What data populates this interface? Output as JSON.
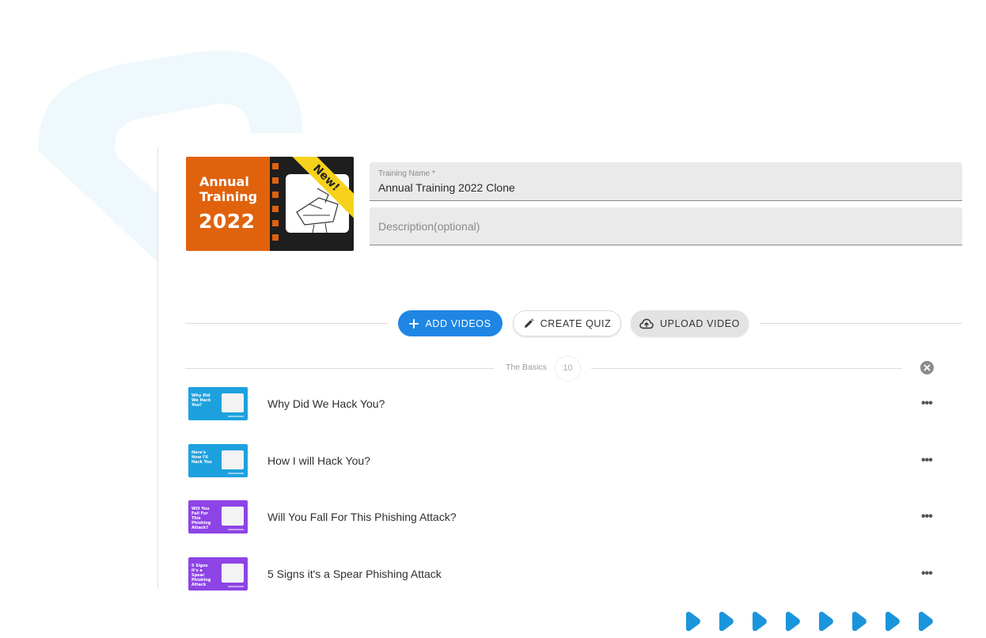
{
  "hero": {
    "title_line1": "Annual",
    "title_line2": "Training",
    "year": "2022",
    "badge": "New!",
    "colors": {
      "background": "#e0620d",
      "ribbon": "#f7d21c"
    }
  },
  "form": {
    "training_name": {
      "label": "Training Name *",
      "value": "Annual Training 2022 Clone"
    },
    "description": {
      "placeholder": "Description(optional)"
    }
  },
  "actions": {
    "add_videos": "ADD VIDEOS",
    "create_quiz": "CREATE QUIZ",
    "upload_video": "UPLOAD VIDEO"
  },
  "section": {
    "title": "The Basics",
    "count": "10"
  },
  "videos": [
    {
      "title": "Why Did We Hack You?",
      "thumb_text": "Why Did We Hack You?",
      "thumb_color": "blue"
    },
    {
      "title": "How I will Hack You?",
      "thumb_text": "Here's How I'll Hack You",
      "thumb_color": "blue"
    },
    {
      "title": "Will You Fall For This Phishing Attack?",
      "thumb_text": "Will You Fall For This Phishing Attack?",
      "thumb_color": "purple"
    },
    {
      "title": "5 Signs it's a Spear Phishing Attack",
      "thumb_text": "5 Signs it's a Spear Phishing Attack",
      "thumb_color": "purple"
    }
  ],
  "menu_glyph": "•••",
  "icons": {
    "add": "plus-icon",
    "quiz": "pencil-icon",
    "upload": "cloud-upload-icon",
    "close": "close-circle-icon",
    "row_menu": "more-horizontal-icon",
    "carousel": "play-dot-icon"
  },
  "colors": {
    "primary": "#1f86e4",
    "carousel": "#1a95dc",
    "swoosh": "#eef8fd"
  }
}
